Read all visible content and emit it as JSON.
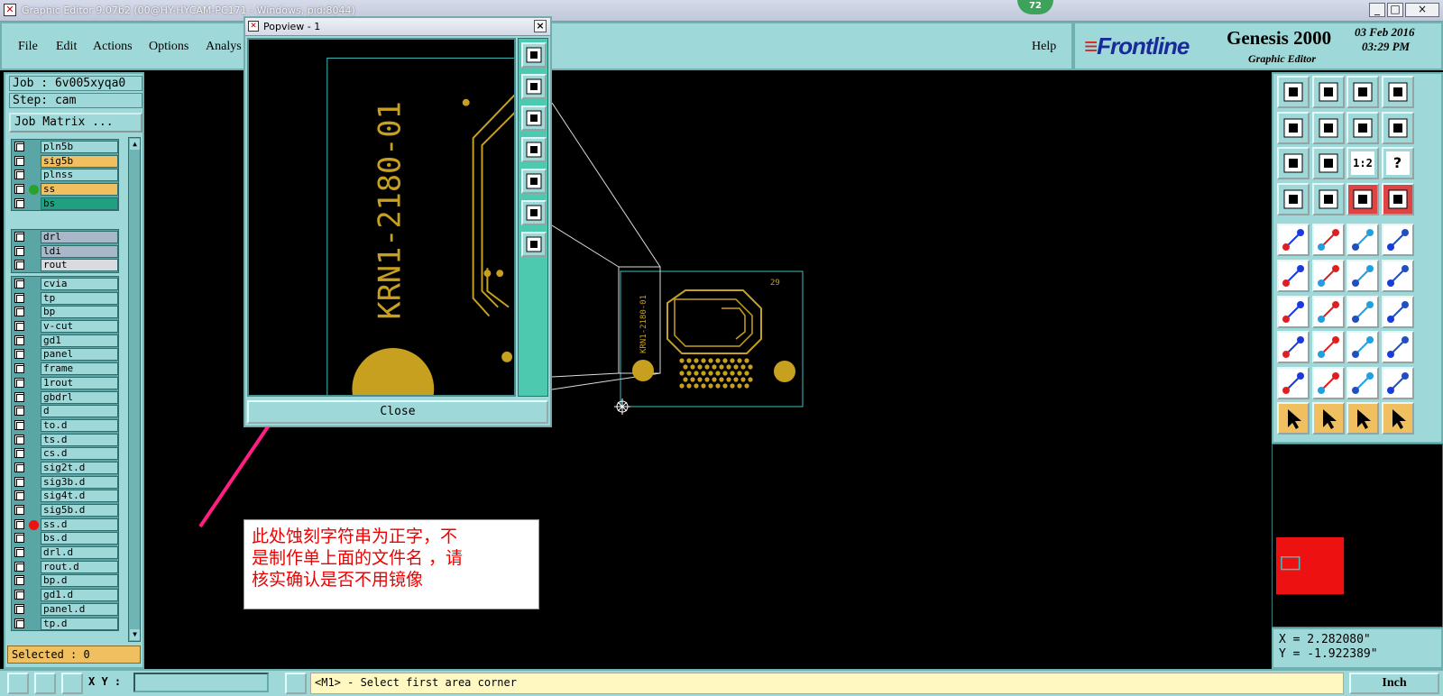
{
  "window": {
    "title": "Graphic Editor 9.07b2 (00@HY-HYCAM-PC171 - Windows, pid:8044)",
    "notification_count": "72",
    "minimize_glyph": "_",
    "maximize_glyph": "□",
    "close_glyph": "×"
  },
  "menu": {
    "items": [
      "File",
      "Edit",
      "Actions",
      "Options",
      "Analys"
    ],
    "help": "Help"
  },
  "brand": {
    "logo_text": "Frontline",
    "product": "Genesis 2000",
    "subtitle": "Graphic Editor",
    "date": "03 Feb 2016",
    "time": "03:29 PM"
  },
  "job": {
    "job_label": "Job : 6v005xyqa0",
    "step_label": "Step: cam",
    "job_matrix_button": "Job Matrix ..."
  },
  "layers": {
    "group1": [
      {
        "name": "pln5b",
        "color": "#9fd8d8"
      },
      {
        "name": "sig5b",
        "color": "#f0c060"
      },
      {
        "name": "plnss",
        "color": "#9fd8d8"
      },
      {
        "name": "ss",
        "color": "#f0c060",
        "dot": "#2ca02c"
      },
      {
        "name": "bs",
        "color": "#20a080"
      }
    ],
    "group2": [
      {
        "name": "drl",
        "color": "#a8b8c8"
      },
      {
        "name": "ldi",
        "color": "#a8b8c8"
      },
      {
        "name": "rout",
        "color": "#d8dce0"
      }
    ],
    "group3": [
      {
        "name": "cvia"
      },
      {
        "name": "tp"
      },
      {
        "name": "bp"
      },
      {
        "name": "v-cut"
      },
      {
        "name": "gd1"
      },
      {
        "name": "panel"
      },
      {
        "name": "frame"
      },
      {
        "name": "1rout"
      },
      {
        "name": "gbdrl"
      },
      {
        "name": "d"
      },
      {
        "name": "to.d"
      },
      {
        "name": "ts.d"
      },
      {
        "name": "cs.d"
      },
      {
        "name": "sig2t.d"
      },
      {
        "name": "sig3b.d"
      },
      {
        "name": "sig4t.d"
      },
      {
        "name": "sig5b.d"
      },
      {
        "name": "ss.d",
        "dot": "#ee1111"
      },
      {
        "name": "bs.d"
      },
      {
        "name": "drl.d"
      },
      {
        "name": "rout.d"
      },
      {
        "name": "bp.d"
      },
      {
        "name": "gd1.d"
      },
      {
        "name": "panel.d"
      },
      {
        "name": "tp.d"
      }
    ],
    "selected": "Selected : 0"
  },
  "popview": {
    "title": "Popview - 1",
    "close_button": "Close",
    "etched_text": "KRN1-2180-01"
  },
  "board": {
    "etched_text": "KRN1-2180-01",
    "corner_label": "29"
  },
  "annotation": {
    "lines": [
      "此处蚀刻字符串为正字，不",
      "是制作单上面的文件名 ，请",
      "核实确认是否不用镜像"
    ]
  },
  "right_tools": {
    "fit_label": "1:2",
    "help_label": "?"
  },
  "coords": {
    "x": "X = 2.282080\"",
    "y": "Y = -1.922389\""
  },
  "bottom": {
    "xy_label": "X Y :",
    "xy_value": "",
    "status": "<M1> - Select first area corner",
    "units": "Inch"
  },
  "colors": {
    "panel": "#9fd8d8",
    "copper": "#c8a020",
    "outline": "#40c0c0",
    "annotation_text": "#e00000",
    "arrow": "#ff1e82"
  }
}
